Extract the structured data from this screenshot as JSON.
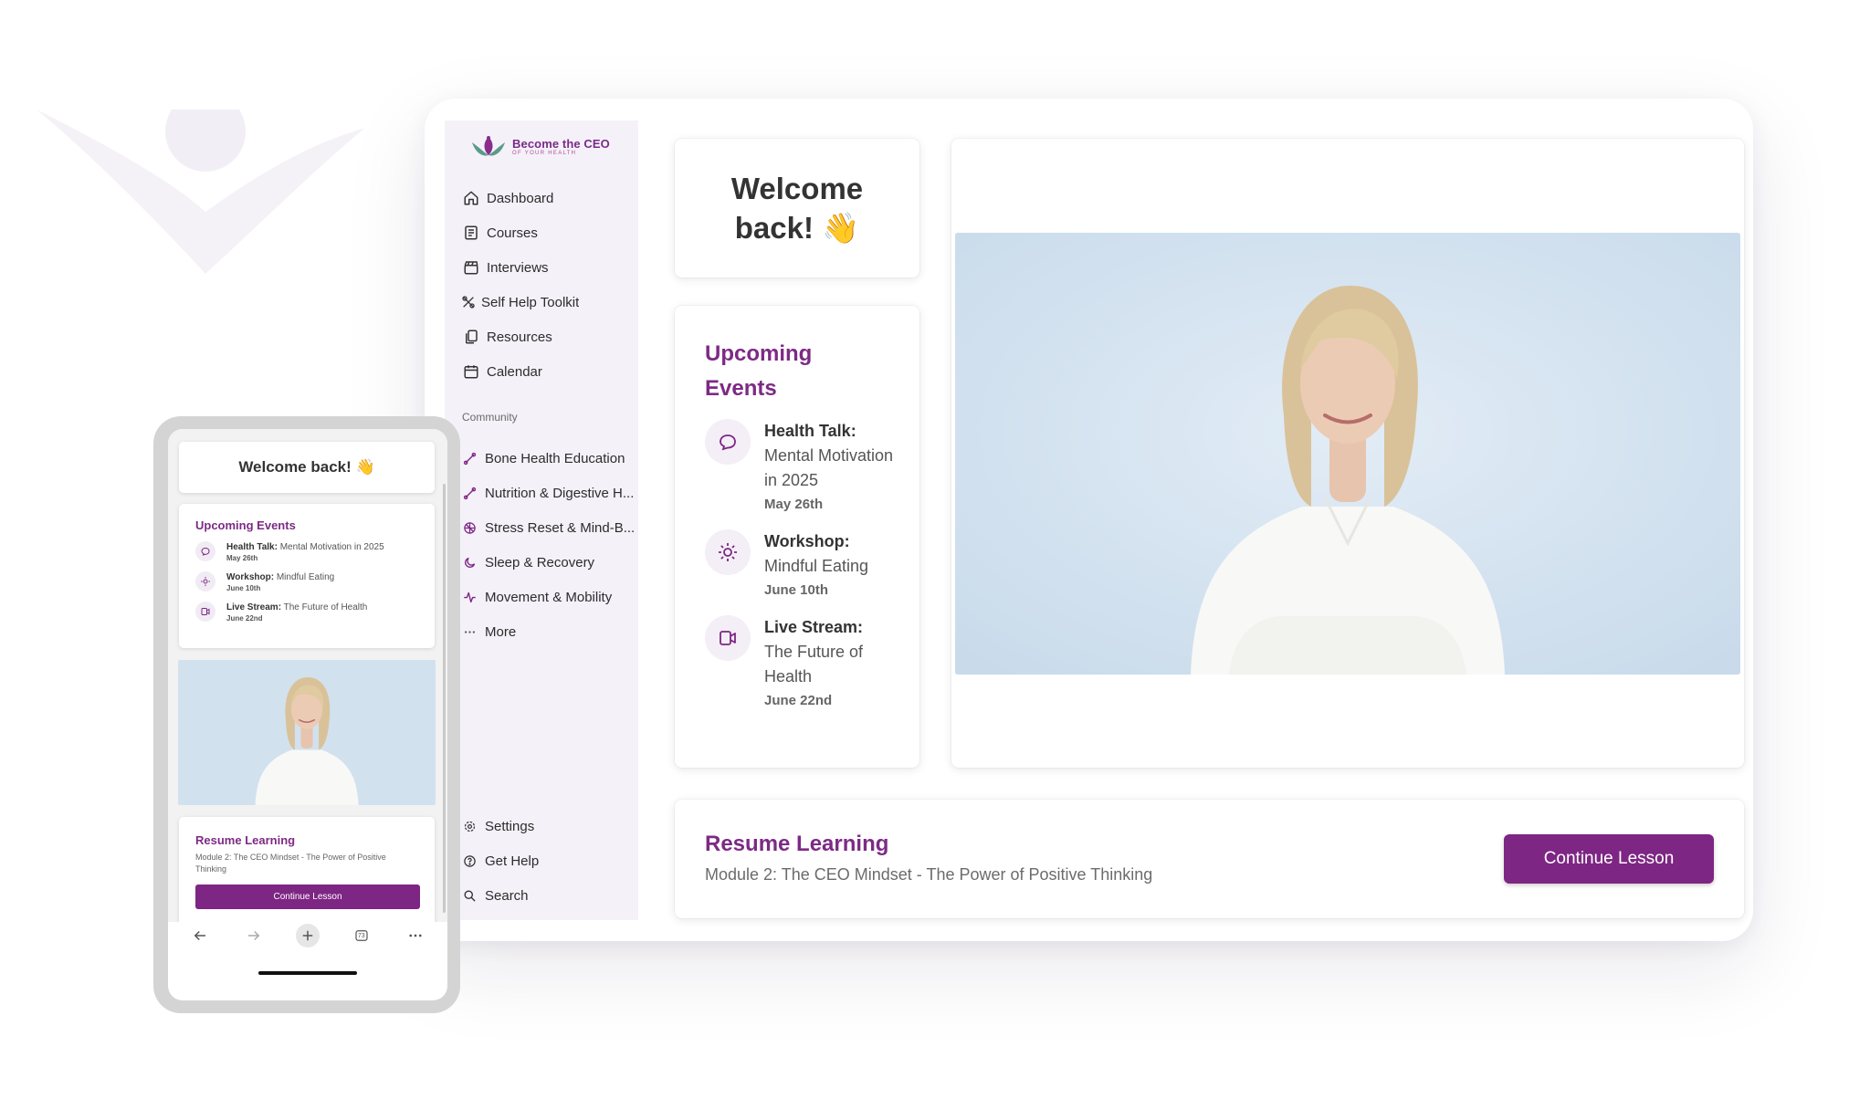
{
  "brand": {
    "name": "Become the CEO",
    "tagline": "OF YOUR HEALTH",
    "purple": "#7d2683",
    "lavender": "#f4f1f8"
  },
  "sidebar": {
    "main_items": [
      {
        "label": "Dashboard",
        "icon": "home-icon"
      },
      {
        "label": "Courses",
        "icon": "book-icon"
      },
      {
        "label": "Interviews",
        "icon": "clapperboard-icon"
      },
      {
        "label": "Self Help Toolkit",
        "icon": "tools-icon"
      },
      {
        "label": "Resources",
        "icon": "files-icon"
      },
      {
        "label": "Calendar",
        "icon": "calendar-icon"
      }
    ],
    "community_label": "Community",
    "community_items": [
      {
        "label": "Bone Health Education",
        "icon": "bone-icon"
      },
      {
        "label": "Nutrition & Digestive H...",
        "icon": "pill-icon"
      },
      {
        "label": "Stress Reset & Mind-B...",
        "icon": "brain-icon"
      },
      {
        "label": "Sleep & Recovery",
        "icon": "moon-icon"
      },
      {
        "label": "Movement & Mobility",
        "icon": "activity-icon"
      },
      {
        "label": "More",
        "icon": "more-icon"
      }
    ],
    "bottom_items": [
      {
        "label": "Settings",
        "icon": "gear-icon"
      },
      {
        "label": "Get Help",
        "icon": "help-circle-icon"
      },
      {
        "label": "Search",
        "icon": "search-icon"
      }
    ]
  },
  "welcome": {
    "text": "Welcome back! 👋"
  },
  "events": {
    "title": "Upcoming Events",
    "items": [
      {
        "type": "Health Talk:",
        "name": "Mental Motivation in 2025",
        "date": "May 26th",
        "icon": "chat-bubble-icon"
      },
      {
        "type": "Workshop:",
        "name": "Mindful Eating",
        "date": "June 10th",
        "icon": "sun-icon"
      },
      {
        "type": "Live Stream:",
        "name": "The Future of Health",
        "date": "June 22nd",
        "icon": "video-camera-icon"
      }
    ]
  },
  "resume": {
    "title": "Resume Learning",
    "subtitle": "Module 2: The CEO Mindset - The Power of Positive Thinking",
    "button": "Continue Lesson"
  },
  "phone": {
    "tabs_count": "73"
  }
}
